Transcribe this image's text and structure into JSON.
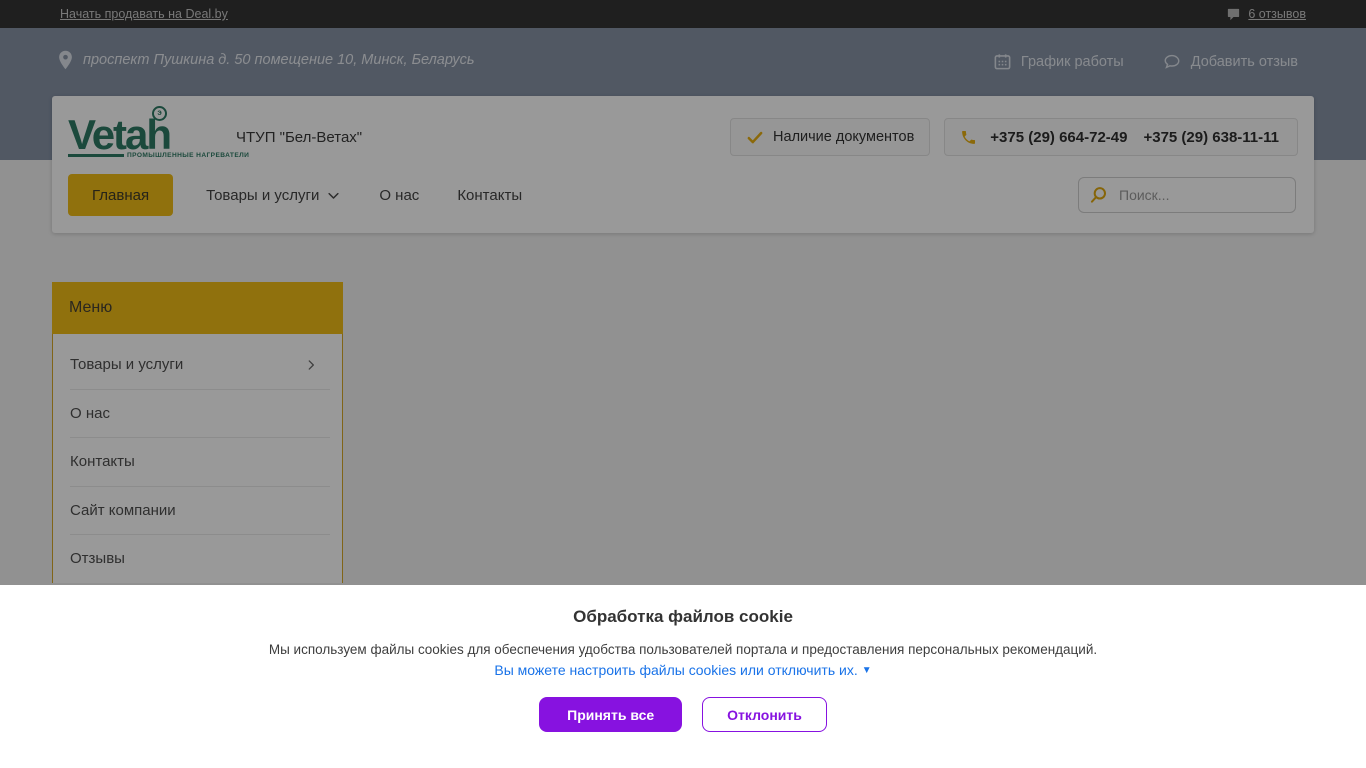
{
  "topbar": {
    "sell_link": "Начать продавать на Deal.by",
    "reviews_link": "6 отзывов"
  },
  "infobar": {
    "address": "проспект Пушкина д. 50 помещение 10, Минск, Беларусь",
    "schedule": "График работы",
    "add_review": "Добавить отзыв"
  },
  "company": {
    "logo_text": "Vetah",
    "logo_mark": "э",
    "logo_subtitle": "ПРОМЫШЛЕННЫЕ НАГРЕВАТЕЛИ",
    "name": "ЧТУП \"Бел-Ветах\"",
    "documents_badge": "Наличие документов",
    "phone1": "+375 (29) 664-72-49",
    "phone2": "+375 (29) 638-11-11"
  },
  "nav": {
    "items": [
      {
        "label": "Главная",
        "active": true
      },
      {
        "label": "Товары и услуги",
        "active": false
      },
      {
        "label": "О нас",
        "active": false
      },
      {
        "label": "Контакты",
        "active": false
      }
    ],
    "search_placeholder": "Поиск..."
  },
  "sidebar": {
    "title": "Меню",
    "items": [
      "Товары и услуги",
      "О нас",
      "Контакты",
      "Сайт компании",
      "Отзывы"
    ]
  },
  "cookie_dialog": {
    "title": "Обработка файлов cookie",
    "message": "Мы используем файлы cookies для обеспечения удобства пользователей портала и предоставления персональных рекомендаций.",
    "settings_link": "Вы можете настроить файлы cookies или отключить их.",
    "settings_arrow": "▼",
    "accept_button": "Принять все",
    "decline_button": "Отклонить"
  },
  "colors": {
    "accent_gold": "#f0bc17",
    "purple": "#8712e0",
    "link_blue": "#1a73e8",
    "logo_green": "#2e7a64",
    "band_slate": "#8793a6"
  }
}
